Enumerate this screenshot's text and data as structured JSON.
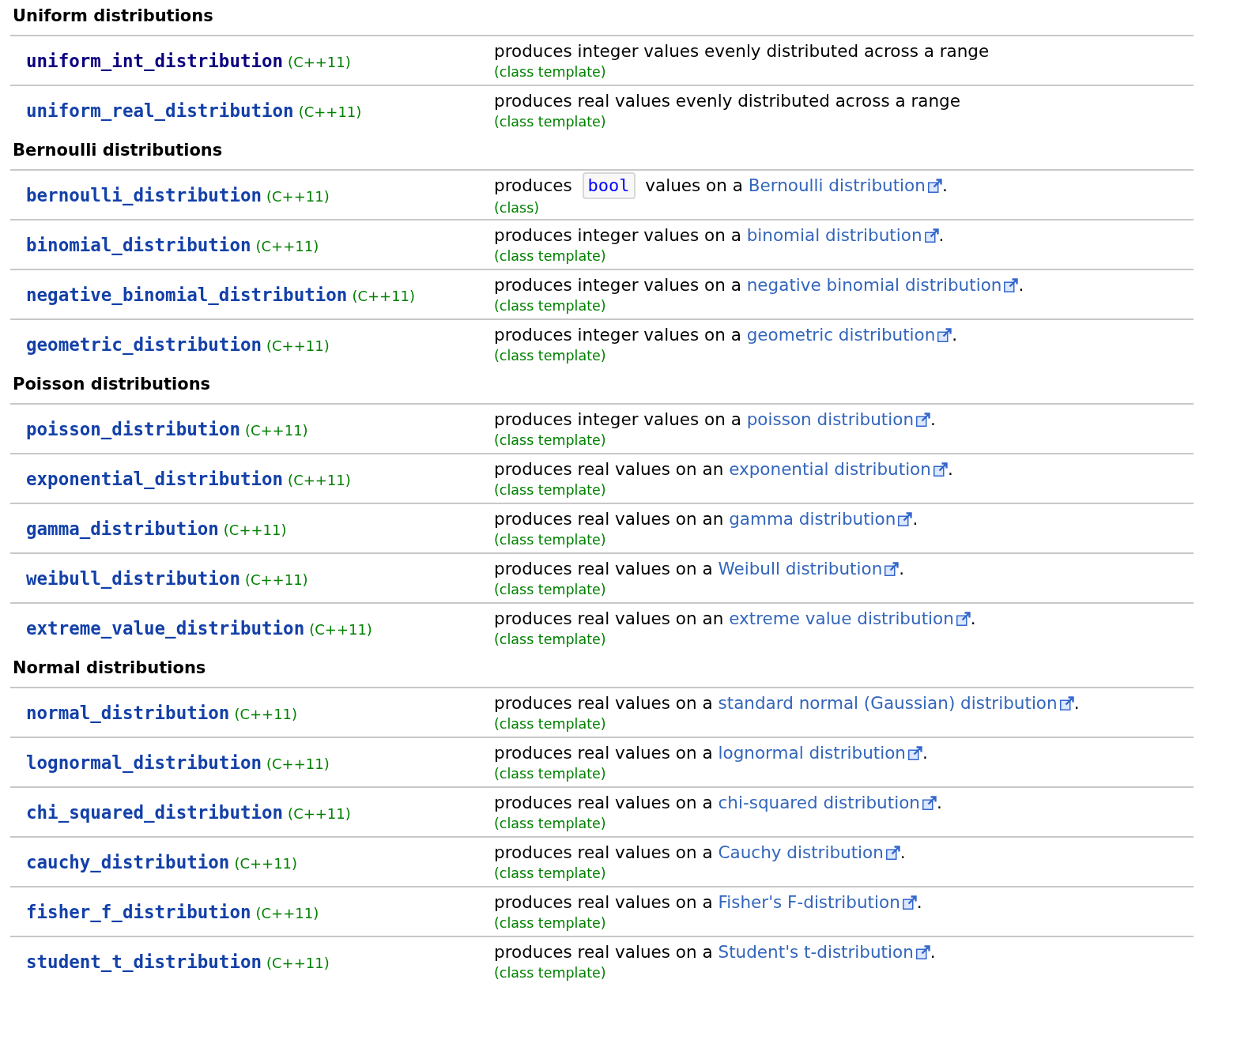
{
  "sections": [
    {
      "heading": "Uniform distributions",
      "rows": [
        {
          "name": "uniform_int_distribution",
          "visited": true,
          "since": "(C++11)",
          "description": [
            {
              "kind": "text",
              "text": "produces integer values evenly distributed across a range"
            }
          ],
          "note": "(class template)"
        },
        {
          "name": "uniform_real_distribution",
          "visited": false,
          "since": "(C++11)",
          "description": [
            {
              "kind": "text",
              "text": "produces real values evenly distributed across a range"
            }
          ],
          "note": "(class template)"
        }
      ]
    },
    {
      "heading": "Bernoulli distributions",
      "rows": [
        {
          "name": "bernoulli_distribution",
          "visited": false,
          "since": "(C++11)",
          "description": [
            {
              "kind": "text",
              "text": "produces "
            },
            {
              "kind": "code",
              "text": "bool"
            },
            {
              "kind": "text",
              "text": " values on a "
            },
            {
              "kind": "link",
              "text": "Bernoulli distribution"
            },
            {
              "kind": "text",
              "text": "."
            }
          ],
          "note": "(class)"
        },
        {
          "name": "binomial_distribution",
          "visited": false,
          "since": "(C++11)",
          "description": [
            {
              "kind": "text",
              "text": "produces integer values on a "
            },
            {
              "kind": "link",
              "text": "binomial distribution"
            },
            {
              "kind": "text",
              "text": "."
            }
          ],
          "note": "(class template)"
        },
        {
          "name": "negative_binomial_distribution",
          "visited": false,
          "since": "(C++11)",
          "description": [
            {
              "kind": "text",
              "text": "produces integer values on a "
            },
            {
              "kind": "link",
              "text": "negative binomial distribution"
            },
            {
              "kind": "text",
              "text": "."
            }
          ],
          "note": "(class template)"
        },
        {
          "name": "geometric_distribution",
          "visited": false,
          "since": "(C++11)",
          "description": [
            {
              "kind": "text",
              "text": "produces integer values on a "
            },
            {
              "kind": "link",
              "text": "geometric distribution"
            },
            {
              "kind": "text",
              "text": "."
            }
          ],
          "note": "(class template)"
        }
      ]
    },
    {
      "heading": "Poisson distributions",
      "rows": [
        {
          "name": "poisson_distribution",
          "visited": false,
          "since": "(C++11)",
          "description": [
            {
              "kind": "text",
              "text": "produces integer values on a "
            },
            {
              "kind": "link",
              "text": "poisson distribution"
            },
            {
              "kind": "text",
              "text": "."
            }
          ],
          "note": "(class template)"
        },
        {
          "name": "exponential_distribution",
          "visited": false,
          "since": "(C++11)",
          "description": [
            {
              "kind": "text",
              "text": "produces real values on an "
            },
            {
              "kind": "link",
              "text": "exponential distribution"
            },
            {
              "kind": "text",
              "text": "."
            }
          ],
          "note": "(class template)"
        },
        {
          "name": "gamma_distribution",
          "visited": false,
          "since": "(C++11)",
          "description": [
            {
              "kind": "text",
              "text": "produces real values on an "
            },
            {
              "kind": "link",
              "text": "gamma distribution"
            },
            {
              "kind": "text",
              "text": "."
            }
          ],
          "note": "(class template)"
        },
        {
          "name": "weibull_distribution",
          "visited": false,
          "since": "(C++11)",
          "description": [
            {
              "kind": "text",
              "text": "produces real values on a "
            },
            {
              "kind": "link",
              "text": "Weibull distribution"
            },
            {
              "kind": "text",
              "text": "."
            }
          ],
          "note": "(class template)"
        },
        {
          "name": "extreme_value_distribution",
          "visited": false,
          "since": "(C++11)",
          "description": [
            {
              "kind": "text",
              "text": "produces real values on an "
            },
            {
              "kind": "link",
              "text": "extreme value distribution"
            },
            {
              "kind": "text",
              "text": "."
            }
          ],
          "note": "(class template)"
        }
      ]
    },
    {
      "heading": "Normal distributions",
      "rows": [
        {
          "name": "normal_distribution",
          "visited": false,
          "since": "(C++11)",
          "description": [
            {
              "kind": "text",
              "text": "produces real values on a "
            },
            {
              "kind": "link",
              "text": "standard normal (Gaussian) distribution"
            },
            {
              "kind": "text",
              "text": "."
            }
          ],
          "note": "(class template)"
        },
        {
          "name": "lognormal_distribution",
          "visited": false,
          "since": "(C++11)",
          "description": [
            {
              "kind": "text",
              "text": "produces real values on a "
            },
            {
              "kind": "link",
              "text": "lognormal distribution"
            },
            {
              "kind": "text",
              "text": "."
            }
          ],
          "note": "(class template)"
        },
        {
          "name": "chi_squared_distribution",
          "visited": false,
          "since": "(C++11)",
          "description": [
            {
              "kind": "text",
              "text": "produces real values on a "
            },
            {
              "kind": "link",
              "text": "chi-squared distribution"
            },
            {
              "kind": "text",
              "text": "."
            }
          ],
          "note": "(class template)"
        },
        {
          "name": "cauchy_distribution",
          "visited": false,
          "since": "(C++11)",
          "description": [
            {
              "kind": "text",
              "text": "produces real values on a "
            },
            {
              "kind": "link",
              "text": "Cauchy distribution"
            },
            {
              "kind": "text",
              "text": "."
            }
          ],
          "note": "(class template)"
        },
        {
          "name": "fisher_f_distribution",
          "visited": false,
          "since": "(C++11)",
          "description": [
            {
              "kind": "text",
              "text": "produces real values on a "
            },
            {
              "kind": "link",
              "text": "Fisher's F-distribution"
            },
            {
              "kind": "text",
              "text": "."
            }
          ],
          "note": "(class template)"
        },
        {
          "name": "student_t_distribution",
          "visited": false,
          "since": "(C++11)",
          "description": [
            {
              "kind": "text",
              "text": "produces real values on a "
            },
            {
              "kind": "link",
              "text": "Student's t-distribution"
            },
            {
              "kind": "text",
              "text": "."
            }
          ],
          "note": "(class template)"
        }
      ]
    }
  ]
}
